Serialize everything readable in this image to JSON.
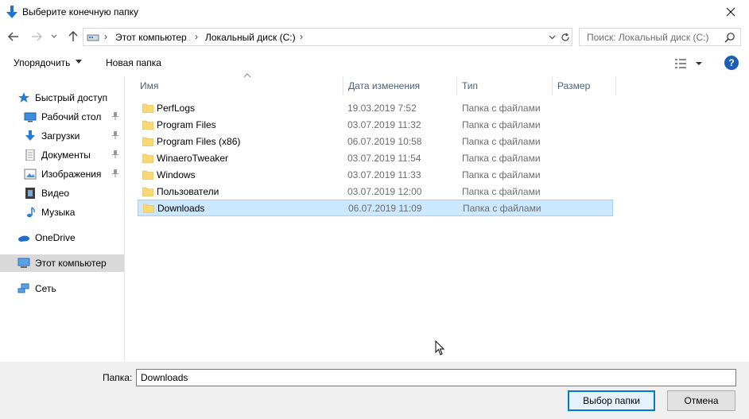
{
  "window": {
    "title": "Выберите конечную папку",
    "icon": "down-arrow-icon"
  },
  "address": {
    "breadcrumbs": [
      "Этот компьютер",
      "Локальный диск (C:)"
    ],
    "separator": "›"
  },
  "search": {
    "placeholder": "Поиск: Локальный диск (C:)"
  },
  "toolbar": {
    "organize_label": "Упорядочить",
    "new_folder_label": "Новая папка",
    "help_label": "?"
  },
  "sidebar": {
    "items": [
      {
        "label": "Быстрый доступ",
        "icon": "star-icon"
      },
      {
        "label": "Рабочий стол",
        "icon": "desktop-icon",
        "pinned": true
      },
      {
        "label": "Загрузки",
        "icon": "downloads-icon",
        "pinned": true
      },
      {
        "label": "Документы",
        "icon": "documents-icon",
        "pinned": true
      },
      {
        "label": "Изображения",
        "icon": "pictures-icon",
        "pinned": true
      },
      {
        "label": "Видео",
        "icon": "video-icon"
      },
      {
        "label": "Музыка",
        "icon": "music-icon"
      },
      {
        "label": "OneDrive",
        "icon": "cloud-icon"
      },
      {
        "label": "Этот компьютер",
        "icon": "computer-icon",
        "selected": true
      },
      {
        "label": "Сеть",
        "icon": "network-icon"
      }
    ]
  },
  "columns": {
    "name": "Имя",
    "date": "Дата изменения",
    "type": "Тип",
    "size": "Размер"
  },
  "files": [
    {
      "name": "PerfLogs",
      "date": "19.03.2019 7:52",
      "type": "Папка с файлами"
    },
    {
      "name": "Program Files",
      "date": "03.07.2019 11:32",
      "type": "Папка с файлами"
    },
    {
      "name": "Program Files (x86)",
      "date": "06.07.2019 10:58",
      "type": "Папка с файлами"
    },
    {
      "name": "WinaeroTweaker",
      "date": "03.07.2019 11:54",
      "type": "Папка с файлами"
    },
    {
      "name": "Windows",
      "date": "03.07.2019 11:33",
      "type": "Папка с файлами"
    },
    {
      "name": "Пользователи",
      "date": "03.07.2019 12:00",
      "type": "Папка с файлами"
    },
    {
      "name": "Downloads",
      "date": "06.07.2019 11:09",
      "type": "Папка с файлами",
      "selected": true
    }
  ],
  "footer": {
    "folder_label": "Папка:",
    "folder_value": "Downloads",
    "select_button": "Выбор папки",
    "cancel_button": "Отмена"
  },
  "colors": {
    "accent": "#0078d7",
    "selection_bg": "#cce8ff",
    "selection_border": "#99d1ff",
    "folder": "#f8d775",
    "header_text": "#4c607a"
  }
}
